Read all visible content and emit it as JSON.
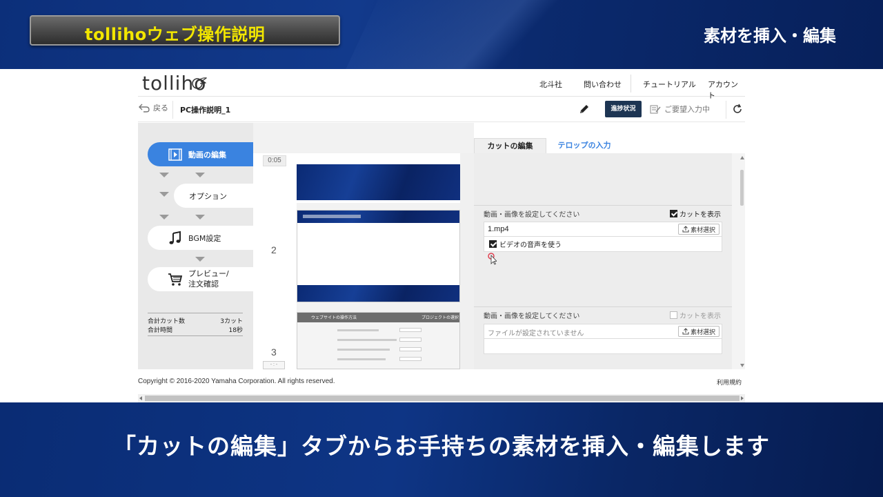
{
  "video": {
    "title_badge": "tollihoウェブ操作説明",
    "section_title": "素材を挿入・編集",
    "subtitle": "「カットの編集」タブからお手持ちの素材を挿入・編集します"
  },
  "header": {
    "logo": "tolliho",
    "nav": [
      "北斗社",
      "問い合わせ",
      "チュートリアル",
      "アカウント"
    ]
  },
  "toolbar": {
    "back_label": "戻る",
    "project_name": "PC操作説明_1",
    "progress_button": "進捗状況",
    "request_label": "ご要望入力中"
  },
  "sidebar": {
    "steps": [
      {
        "label": "動画の編集",
        "icon": "film-icon",
        "active": true
      },
      {
        "label": "オプション",
        "icon": "",
        "active": false
      },
      {
        "label": "BGM設定",
        "icon": "music-note-icon",
        "active": false
      },
      {
        "label": "プレビュー/",
        "label2": "注文確認",
        "icon": "cart-icon",
        "active": false
      }
    ],
    "totals": {
      "cuts_label": "合計カット数",
      "cuts_value": "3カット",
      "time_label": "合計時間",
      "time_value": "18秒"
    }
  },
  "timeline": {
    "timecode": "0:05",
    "cut_numbers": [
      "2",
      "3"
    ],
    "thumb3_title_left": "ウェブサイトの操作方法",
    "thumb3_title_right": "プロジェクトの選択"
  },
  "panel": {
    "tabs": [
      "カットの編集",
      "テロップの入力"
    ],
    "sections": [
      {
        "set_label": "動画・画像を設定してください",
        "show_cut_label": "カットを表示",
        "show_cut_checked": true,
        "file_value": "1.mp4",
        "select_button": "素材選択",
        "use_audio_label": "ビデオの音声を使う",
        "use_audio_checked": true
      },
      {
        "set_label": "動画・画像を設定してください",
        "show_cut_label": "カットを表示",
        "show_cut_checked": false,
        "file_placeholder": "ファイルが設定されていません",
        "select_button": "素材選択"
      }
    ]
  },
  "footer": {
    "copyright": "Copyright © 2016-2020 Yamaha Corporation. All rights reserved.",
    "terms": "利用規約"
  },
  "colors": {
    "accent": "#3a83e0",
    "progress_button_bg": "#1d3553",
    "badge_text": "#f2e600",
    "frame_blue": "#0c2f7a"
  }
}
